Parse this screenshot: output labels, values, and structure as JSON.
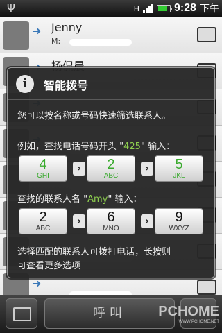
{
  "status_bar": {
    "usb_icon": "usb-icon",
    "notification_label": "H",
    "time": "9:28",
    "ampm": "下午",
    "battery_level": 0.8
  },
  "contacts": [
    {
      "name": "Jenny",
      "sub": "M:"
    },
    {
      "name": "杨侃晨",
      "sub": ""
    },
    {
      "name": "",
      "sub": ""
    },
    {
      "name": "",
      "sub": ""
    },
    {
      "name": "",
      "sub": ""
    },
    {
      "name": "",
      "sub": ""
    },
    {
      "name": "",
      "sub": ""
    },
    {
      "name": "",
      "sub": ""
    }
  ],
  "dialog": {
    "title": "智能拨号",
    "intro": "您可以按名称或号码快速筛选联系人。",
    "example1_prefix": "例如，查找电话号码开头 \"",
    "example1_value": "425",
    "example1_suffix": "\" 输入：",
    "number_keys": [
      {
        "digit": "4",
        "letters": "GHI"
      },
      {
        "digit": "2",
        "letters": "ABC"
      },
      {
        "digit": "5",
        "letters": "JKL"
      }
    ],
    "example2_prefix": "查找的联系人名 \"",
    "example2_value": "Amy",
    "example2_suffix": "\" 输入：",
    "name_keys": [
      {
        "digit": "2",
        "letters": "ABC"
      },
      {
        "digit": "6",
        "letters": "MNO"
      },
      {
        "digit": "9",
        "letters": "WXYZ"
      }
    ],
    "footer_line1": "选择匹配的联系人可拨打电话，长按则",
    "footer_line2": "可查看更多选项"
  },
  "bottom_bar": {
    "call_label": "呼叫"
  },
  "watermark": {
    "brand": "PCHOME",
    "url": "WWW.PCHOME.NET"
  },
  "colors": {
    "highlight": "#8fd14f",
    "key_green": "#3aaa2e",
    "battery": "#33cc33"
  }
}
